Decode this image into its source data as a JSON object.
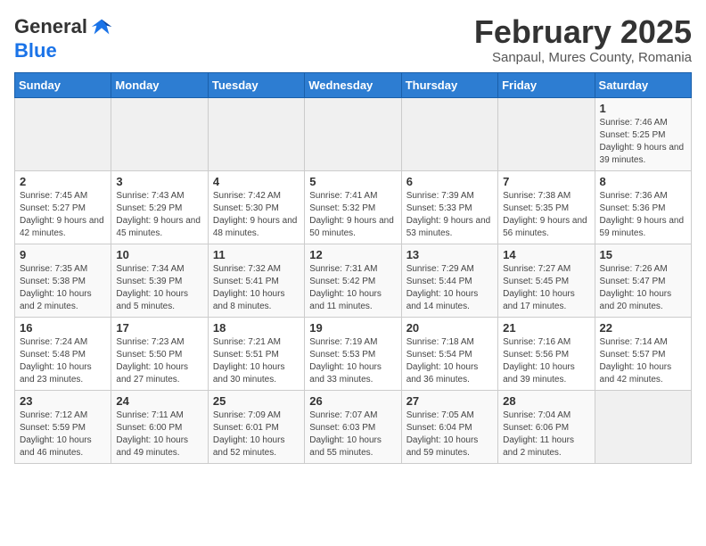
{
  "logo": {
    "general": "General",
    "blue": "Blue"
  },
  "title": "February 2025",
  "location": "Sanpaul, Mures County, Romania",
  "weekdays": [
    "Sunday",
    "Monday",
    "Tuesday",
    "Wednesday",
    "Thursday",
    "Friday",
    "Saturday"
  ],
  "weeks": [
    [
      {
        "day": "",
        "info": ""
      },
      {
        "day": "",
        "info": ""
      },
      {
        "day": "",
        "info": ""
      },
      {
        "day": "",
        "info": ""
      },
      {
        "day": "",
        "info": ""
      },
      {
        "day": "",
        "info": ""
      },
      {
        "day": "1",
        "info": "Sunrise: 7:46 AM\nSunset: 5:25 PM\nDaylight: 9 hours and 39 minutes."
      }
    ],
    [
      {
        "day": "2",
        "info": "Sunrise: 7:45 AM\nSunset: 5:27 PM\nDaylight: 9 hours and 42 minutes."
      },
      {
        "day": "3",
        "info": "Sunrise: 7:43 AM\nSunset: 5:29 PM\nDaylight: 9 hours and 45 minutes."
      },
      {
        "day": "4",
        "info": "Sunrise: 7:42 AM\nSunset: 5:30 PM\nDaylight: 9 hours and 48 minutes."
      },
      {
        "day": "5",
        "info": "Sunrise: 7:41 AM\nSunset: 5:32 PM\nDaylight: 9 hours and 50 minutes."
      },
      {
        "day": "6",
        "info": "Sunrise: 7:39 AM\nSunset: 5:33 PM\nDaylight: 9 hours and 53 minutes."
      },
      {
        "day": "7",
        "info": "Sunrise: 7:38 AM\nSunset: 5:35 PM\nDaylight: 9 hours and 56 minutes."
      },
      {
        "day": "8",
        "info": "Sunrise: 7:36 AM\nSunset: 5:36 PM\nDaylight: 9 hours and 59 minutes."
      }
    ],
    [
      {
        "day": "9",
        "info": "Sunrise: 7:35 AM\nSunset: 5:38 PM\nDaylight: 10 hours and 2 minutes."
      },
      {
        "day": "10",
        "info": "Sunrise: 7:34 AM\nSunset: 5:39 PM\nDaylight: 10 hours and 5 minutes."
      },
      {
        "day": "11",
        "info": "Sunrise: 7:32 AM\nSunset: 5:41 PM\nDaylight: 10 hours and 8 minutes."
      },
      {
        "day": "12",
        "info": "Sunrise: 7:31 AM\nSunset: 5:42 PM\nDaylight: 10 hours and 11 minutes."
      },
      {
        "day": "13",
        "info": "Sunrise: 7:29 AM\nSunset: 5:44 PM\nDaylight: 10 hours and 14 minutes."
      },
      {
        "day": "14",
        "info": "Sunrise: 7:27 AM\nSunset: 5:45 PM\nDaylight: 10 hours and 17 minutes."
      },
      {
        "day": "15",
        "info": "Sunrise: 7:26 AM\nSunset: 5:47 PM\nDaylight: 10 hours and 20 minutes."
      }
    ],
    [
      {
        "day": "16",
        "info": "Sunrise: 7:24 AM\nSunset: 5:48 PM\nDaylight: 10 hours and 23 minutes."
      },
      {
        "day": "17",
        "info": "Sunrise: 7:23 AM\nSunset: 5:50 PM\nDaylight: 10 hours and 27 minutes."
      },
      {
        "day": "18",
        "info": "Sunrise: 7:21 AM\nSunset: 5:51 PM\nDaylight: 10 hours and 30 minutes."
      },
      {
        "day": "19",
        "info": "Sunrise: 7:19 AM\nSunset: 5:53 PM\nDaylight: 10 hours and 33 minutes."
      },
      {
        "day": "20",
        "info": "Sunrise: 7:18 AM\nSunset: 5:54 PM\nDaylight: 10 hours and 36 minutes."
      },
      {
        "day": "21",
        "info": "Sunrise: 7:16 AM\nSunset: 5:56 PM\nDaylight: 10 hours and 39 minutes."
      },
      {
        "day": "22",
        "info": "Sunrise: 7:14 AM\nSunset: 5:57 PM\nDaylight: 10 hours and 42 minutes."
      }
    ],
    [
      {
        "day": "23",
        "info": "Sunrise: 7:12 AM\nSunset: 5:59 PM\nDaylight: 10 hours and 46 minutes."
      },
      {
        "day": "24",
        "info": "Sunrise: 7:11 AM\nSunset: 6:00 PM\nDaylight: 10 hours and 49 minutes."
      },
      {
        "day": "25",
        "info": "Sunrise: 7:09 AM\nSunset: 6:01 PM\nDaylight: 10 hours and 52 minutes."
      },
      {
        "day": "26",
        "info": "Sunrise: 7:07 AM\nSunset: 6:03 PM\nDaylight: 10 hours and 55 minutes."
      },
      {
        "day": "27",
        "info": "Sunrise: 7:05 AM\nSunset: 6:04 PM\nDaylight: 10 hours and 59 minutes."
      },
      {
        "day": "28",
        "info": "Sunrise: 7:04 AM\nSunset: 6:06 PM\nDaylight: 11 hours and 2 minutes."
      },
      {
        "day": "",
        "info": ""
      }
    ]
  ]
}
